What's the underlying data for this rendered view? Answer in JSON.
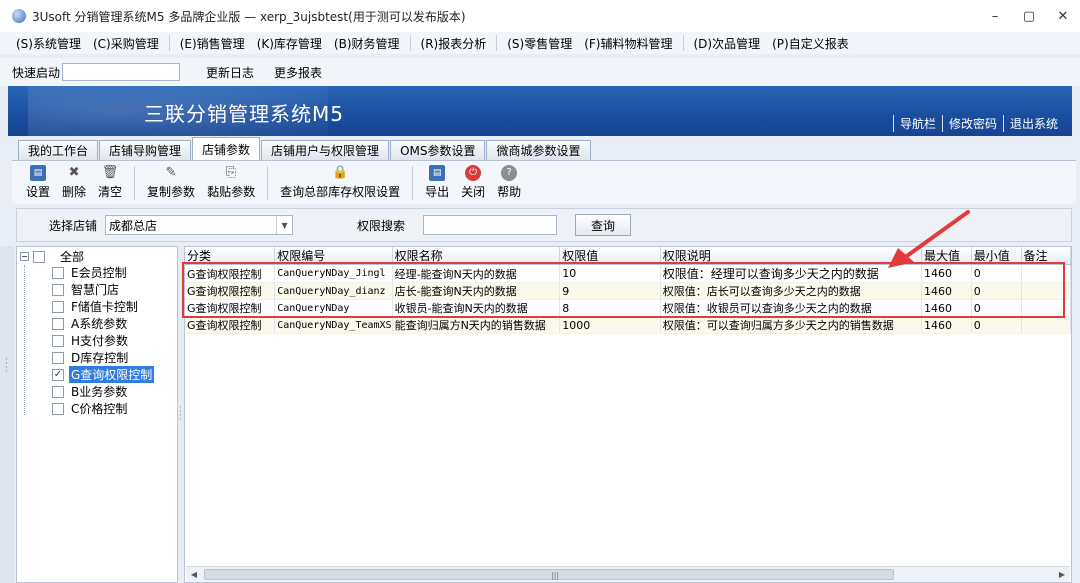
{
  "window": {
    "title": "3Usoft 分销管理系统M5 多品牌企业版 — xerp_3ujsbtest(用于测可以发布版本)",
    "controls": [
      "–",
      "▢",
      "✕"
    ]
  },
  "menu": [
    {
      "label": "(S)系统管理"
    },
    {
      "label": "(C)采购管理"
    },
    {
      "label": "(E)销售管理"
    },
    {
      "label": "(K)库存管理"
    },
    {
      "label": "(B)财务管理"
    },
    {
      "label": "(R)报表分析"
    },
    {
      "label": "(S)零售管理"
    },
    {
      "label": "(F)辅料物料管理"
    },
    {
      "label": "(D)次品管理"
    },
    {
      "label": "(P)自定义报表"
    }
  ],
  "quickbar": {
    "launch_label": "快速启动",
    "launch_value": "",
    "changelog": "更新日志",
    "more_reports": "更多报表"
  },
  "banner": {
    "title": "三联分销管理系统M5",
    "links": [
      "导航栏",
      "修改密码",
      "退出系统"
    ]
  },
  "tabs": [
    {
      "label": "我的工作台",
      "active": false
    },
    {
      "label": "店铺导购管理",
      "active": false
    },
    {
      "label": "店铺参数",
      "active": true
    },
    {
      "label": "店铺用户与权限管理",
      "active": false
    },
    {
      "label": "OMS参数设置",
      "active": false
    },
    {
      "label": "微商城参数设置",
      "active": false
    }
  ],
  "toolbar": {
    "setup": "设置",
    "delete": "删除",
    "clear": "清空",
    "copy_params": "复制参数",
    "paste_params": "黏贴参数",
    "query_perm": "查询总部库存权限设置",
    "export": "导出",
    "close": "关闭",
    "help": "帮助"
  },
  "filter": {
    "store_label": "选择店铺",
    "store_value": "成都总店",
    "search_label": "权限搜索",
    "search_value": "",
    "query_button": "查询"
  },
  "tree": {
    "root": "全部",
    "items": [
      {
        "label": "E会员控制",
        "checked": false
      },
      {
        "label": "智慧门店",
        "checked": false
      },
      {
        "label": "F储值卡控制",
        "checked": false
      },
      {
        "label": "A系统参数",
        "checked": false
      },
      {
        "label": "H支付参数",
        "checked": false
      },
      {
        "label": "D库存控制",
        "checked": false
      },
      {
        "label": "G查询权限控制",
        "checked": true
      },
      {
        "label": "B业务参数",
        "checked": false
      },
      {
        "label": "C价格控制",
        "checked": false
      }
    ]
  },
  "grid": {
    "columns": [
      "分类",
      "权限编号",
      "权限名称",
      "权限值",
      "权限说明",
      "最大值",
      "最小值",
      "备注"
    ],
    "rows": [
      [
        "G查询权限控制",
        "CanQueryNDay_Jingl",
        "经理-能查询N天内的数据",
        "10",
        "权限值：经理可以查询多少天之内的数据",
        "1460",
        "0",
        ""
      ],
      [
        "G查询权限控制",
        "CanQueryNDay_dianz",
        "店长-能查询N天内的数据",
        "9",
        "权限值：店长可以查询多少天之内的数据",
        "1460",
        "0",
        ""
      ],
      [
        "G查询权限控制",
        "CanQueryNDay",
        "收银员-能查询N天内的数据",
        "8",
        "权限值：收银员可以查询多少天之内的数据",
        "1460",
        "0",
        ""
      ],
      [
        "G查询权限控制",
        "CanQueryNDay_TeamXS",
        "能查询归属方N天内的销售数据",
        "1000",
        "权限值：可以查询归属方多少天之内的销售数据",
        "1460",
        "0",
        ""
      ]
    ]
  },
  "colors": {
    "banner": "#1b4fa0",
    "highlight": "#e23b3b",
    "selection": "#2f7de1"
  }
}
